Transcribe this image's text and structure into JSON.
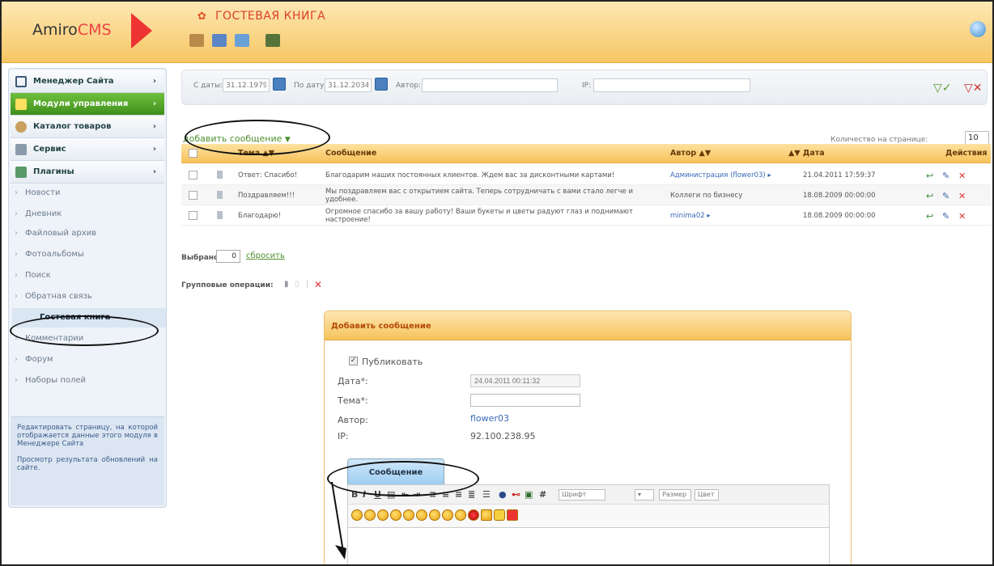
{
  "app": {
    "logo_text": "Amiro",
    "logo_accent": "CMS",
    "page_title": "ГОСТЕВАЯ КНИГА"
  },
  "toolbar": {
    "icons": [
      "tools-icon",
      "save-icon",
      "copy-icon",
      "calculator-icon"
    ]
  },
  "sidebar": {
    "sections": [
      {
        "label": "Менеджер Сайта"
      },
      {
        "label": "Модули управления"
      },
      {
        "label": "Каталог товаров"
      },
      {
        "label": "Сервис"
      },
      {
        "label": "Плагины"
      }
    ],
    "items": [
      "Новости",
      "Дневник",
      "Файловый архив",
      "Фотоальбомы",
      "Поиск",
      "Обратная связь",
      "Гостевая книга",
      "Комментарии",
      "Форум",
      "Наборы полей"
    ],
    "help_edit": "Редактировать страницу, на которой отображается данные этого модуля в Менеджере Сайта",
    "help_view": "Просмотр результата обновлений на сайте."
  },
  "filter": {
    "from_label": "С даты:",
    "from_value": "31.12.1979",
    "to_label": "По дату:",
    "to_value": "31.12.2034",
    "author_label": "Автор:",
    "author_value": "",
    "ip_label": "IP:",
    "ip_value": ""
  },
  "list": {
    "add_link": "добавить сообщение",
    "perpage_label": "Количество на странице:",
    "perpage_value": "10",
    "columns": {
      "topic": "Тема",
      "message": "Сообщение",
      "author": "Автор",
      "date": "Дата",
      "actions": "Действия"
    },
    "rows": [
      {
        "topic": "Ответ: Спасибо!",
        "message": "Благодарим наших постоянных клиентов. Ждем вас за дисконтными картами!",
        "author": "Администрация (flower03)",
        "date": "21.04.2011 17:59:37"
      },
      {
        "topic": "Поздравляем!!!",
        "message": "Мы поздравляем вас с открытием сайта. Теперь сотрудничать с вами стало легче и удобнее.",
        "author": "Коллеги по бизнесу",
        "date": "18.08.2009 00:00:00"
      },
      {
        "topic": "Благодарю!",
        "message": "Огромное спасибо за вашу работу! Ваши букеты и цветы радуют глаз и поднимают настроение!",
        "author": "minima02",
        "date": "18.08.2009 00:00:00"
      }
    ],
    "selected_label": "Выбрано:",
    "selected_value": "0",
    "reset": "сбросить",
    "group_ops": "Групповые операции:"
  },
  "form": {
    "title": "Добавить сообщение",
    "publish": "Публиковать",
    "date_label": "Дата*:",
    "date_value": "24.04.2011 00:11:32",
    "topic_label": "Тема*:",
    "author_label": "Автор:",
    "author_value": "flower03",
    "ip_label": "IP:",
    "ip_value": "92.100.238.95",
    "tab": "Сообщение",
    "font_select": "Шрифт",
    "size_select": "Размер",
    "color_select": "Цвет"
  }
}
